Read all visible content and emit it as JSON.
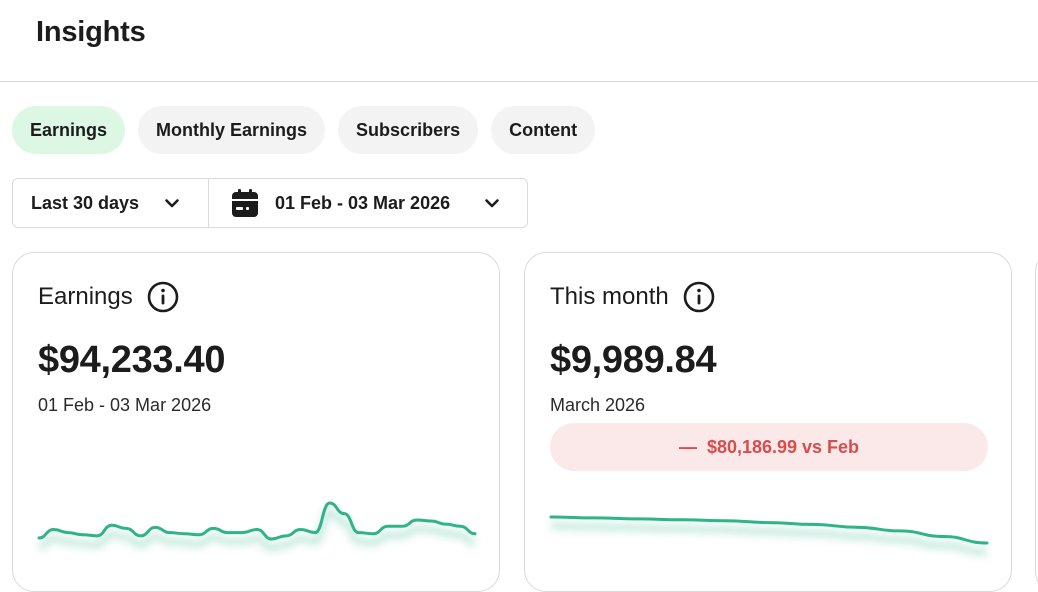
{
  "header": {
    "title": "Insights"
  },
  "tabs": [
    {
      "label": "Earnings",
      "active": true
    },
    {
      "label": "Monthly Earnings",
      "active": false
    },
    {
      "label": "Subscribers",
      "active": false
    },
    {
      "label": "Content",
      "active": false
    }
  ],
  "filters": {
    "range": "Last 30 days",
    "date_range": "01 Feb - 03 Mar 2026"
  },
  "cards": {
    "earnings": {
      "title": "Earnings",
      "amount": "$94,233.40",
      "period": "01 Feb - 03 Mar 2026"
    },
    "this_month": {
      "title": "This month",
      "amount": "$9,989.84",
      "period": "March 2026",
      "delta": "$80,186.99 vs Feb",
      "delta_sign": "—"
    }
  },
  "colors": {
    "accent_green": "#2fb487",
    "active_tab_bg": "#dcf7e4",
    "negative_red": "#d94c4c",
    "negative_bg": "#fbe9e9"
  },
  "sparklines": {
    "earnings_trend": [
      2,
      10,
      7,
      5,
      4,
      14,
      11,
      4,
      12,
      7,
      6,
      5,
      11,
      7,
      7,
      10,
      1,
      4,
      10,
      7,
      35,
      25,
      7,
      6,
      13,
      13,
      19,
      18,
      15,
      13,
      6
    ],
    "this_month_trend": [
      28,
      27,
      26,
      25,
      24,
      22,
      20,
      17,
      13,
      7,
      0
    ]
  }
}
